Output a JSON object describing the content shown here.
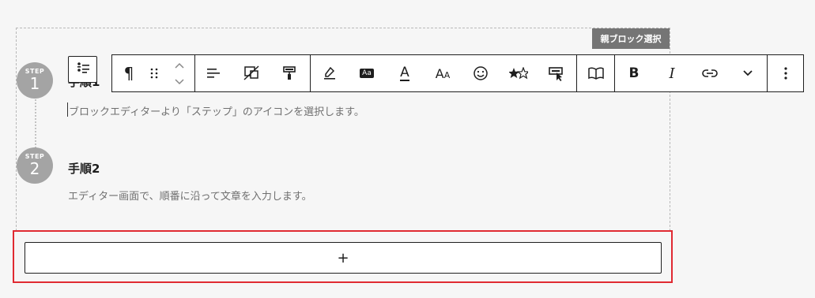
{
  "parent_block_label": "親ブロック選択",
  "steps": [
    {
      "badge": "STEP",
      "number": "1",
      "title": "手順1",
      "description": "ブロックエディターより「ステップ」のアイコンを選択します。"
    },
    {
      "badge": "STEP",
      "number": "2",
      "title": "手順2",
      "description": "エディター画面で、順番に沿って文章を入力します。"
    }
  ],
  "toolbar": {
    "paragraph_glyph": "¶",
    "bold_label": "B",
    "italic_label": "I",
    "highlight_label": "Aa",
    "text_color_label": "A",
    "font_size_label": "A",
    "font_size_small_label": "A"
  },
  "appender": {
    "plus_label": "+"
  },
  "colors": {
    "accent_red": "#e02a32",
    "step_gray": "#a4a4a4",
    "toolbar_border": "#1e1e1e"
  }
}
